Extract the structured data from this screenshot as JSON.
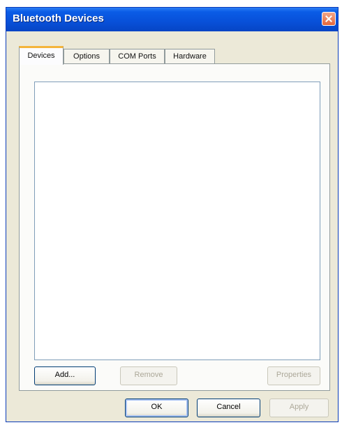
{
  "window": {
    "title": "Bluetooth Devices"
  },
  "tabs": [
    {
      "label": "Devices",
      "active": true
    },
    {
      "label": "Options",
      "active": false
    },
    {
      "label": "COM Ports",
      "active": false
    },
    {
      "label": "Hardware",
      "active": false
    }
  ],
  "device_list": {
    "items": []
  },
  "panel_buttons": {
    "add": {
      "label": "Add...",
      "enabled": true
    },
    "remove": {
      "label": "Remove",
      "enabled": false
    },
    "properties": {
      "label": "Properties",
      "enabled": false
    }
  },
  "dialog_buttons": {
    "ok": {
      "label": "OK",
      "enabled": true
    },
    "cancel": {
      "label": "Cancel",
      "enabled": true
    },
    "apply": {
      "label": "Apply",
      "enabled": false
    }
  },
  "icons": {
    "close": "close-icon"
  },
  "colors": {
    "titlebar": "#0850d8",
    "dialog_bg": "#ece9d8",
    "active_tab_accent": "#f4b43a",
    "button_border": "#003c74"
  }
}
